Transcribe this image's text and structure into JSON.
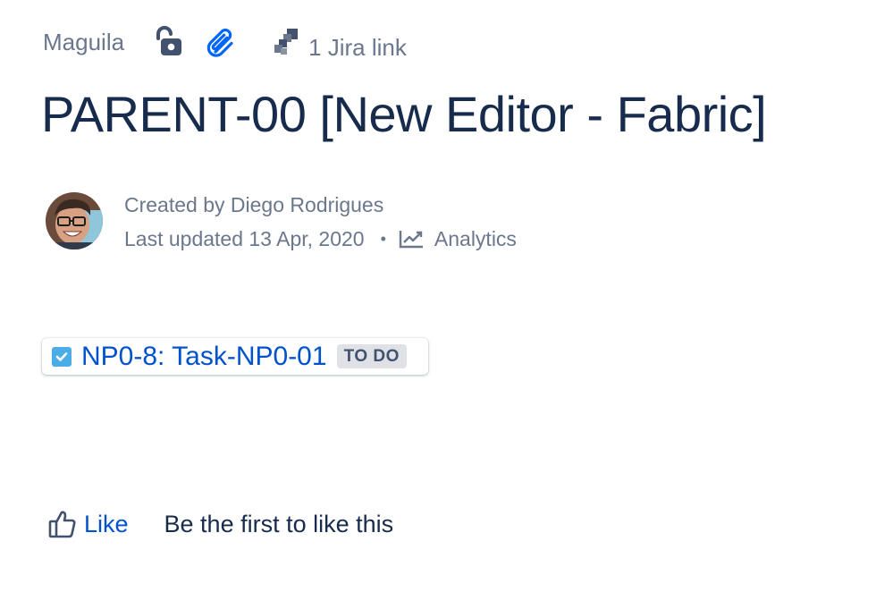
{
  "meta": {
    "space_name": "Maguila",
    "jira_link_text": "1 Jira link"
  },
  "page": {
    "title": "PARENT-00 [New Editor - Fabric]"
  },
  "byline": {
    "created_by": "Created by Diego Rodrigues",
    "last_updated": "Last updated 13 Apr, 2020",
    "separator": "•",
    "analytics_label": "Analytics"
  },
  "jira_issue": {
    "key_summary": "NP0-8: Task-NP0-01",
    "status": "TO DO",
    "status_color": "#dfe1e6",
    "type_icon": "task-checkbox-icon",
    "type_color": "#4bade8"
  },
  "reactions": {
    "like_label": "Like",
    "like_message": "Be the first to like this"
  },
  "colors": {
    "link": "#0052cc",
    "muted": "#6b778c",
    "text": "#172b4d"
  }
}
